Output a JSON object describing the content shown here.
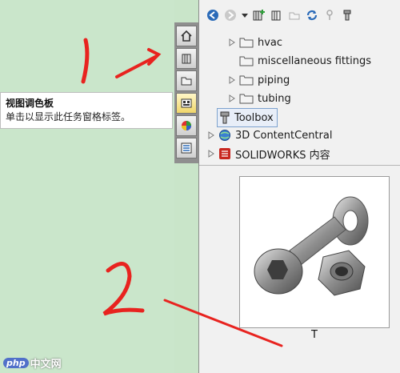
{
  "tooltip": {
    "title": "视图调色板",
    "body": "单击以显示此任务窗格标签。"
  },
  "tabs": [
    {
      "icon": "home-icon"
    },
    {
      "icon": "design-library-icon"
    },
    {
      "icon": "file-explorer-icon"
    },
    {
      "icon": "view-palette-icon"
    },
    {
      "icon": "appearances-icon"
    },
    {
      "icon": "custom-properties-icon"
    }
  ],
  "toolbar": [
    {
      "icon": "back-icon"
    },
    {
      "icon": "forward-icon"
    },
    {
      "icon": "dropdown-icon"
    },
    {
      "icon": "add-to-library-icon"
    },
    {
      "icon": "add-folder-icon"
    },
    {
      "icon": "new-folder-icon"
    },
    {
      "icon": "refresh-icon"
    },
    {
      "icon": "help-icon"
    },
    {
      "icon": "toolbox-settings-icon"
    }
  ],
  "tree": {
    "hvac": "hvac",
    "misc": "miscellaneous fittings",
    "piping": "piping",
    "tubing": "tubing",
    "toolbox": "Toolbox",
    "content_central": "3D ContentCentral",
    "solidworks": "SOLIDWORKS 内容"
  },
  "preview": {
    "caption": "T"
  },
  "annotations": {
    "num1": "1",
    "num2": "2"
  },
  "watermark": {
    "logo": "php",
    "text": "中文网"
  },
  "colors": {
    "background": "#cae6cb",
    "arrow": "#e8231f",
    "accent": "#2a6ab8"
  }
}
